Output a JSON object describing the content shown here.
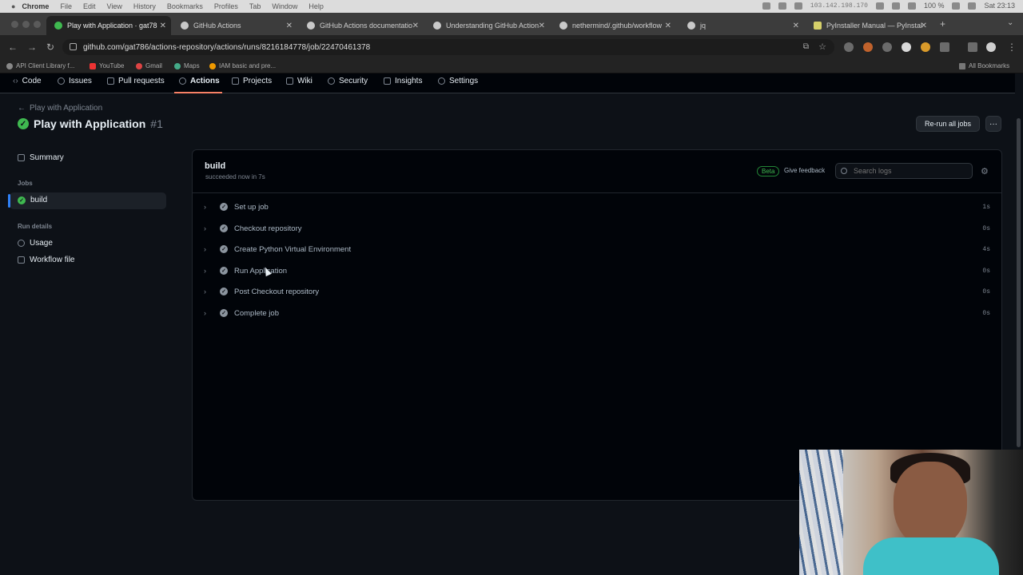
{
  "menubar": {
    "app": "Chrome",
    "items": [
      "File",
      "Edit",
      "View",
      "History",
      "Bookmarks",
      "Profiles",
      "Tab",
      "Window",
      "Help"
    ],
    "ip": "103.142.198.170",
    "battery": "100 %",
    "clock": "Sat 23:13"
  },
  "tabs": [
    {
      "label": "Play with Application · gat78",
      "icon": "github-actions-check-icon"
    },
    {
      "label": "GitHub Actions",
      "icon": "github-icon"
    },
    {
      "label": "GitHub Actions documentatio",
      "icon": "github-icon"
    },
    {
      "label": "Understanding GitHub Action",
      "icon": "github-icon"
    },
    {
      "label": "nethermind/.github/workflow",
      "icon": "github-icon"
    },
    {
      "label": "jq",
      "icon": "jq-icon"
    },
    {
      "label": "PyInstaller Manual — PyInstal",
      "icon": "python-icon"
    }
  ],
  "address": {
    "url": "github.com/gat786/actions-repository/actions/runs/8216184778/job/22470461378"
  },
  "bookmarks": [
    {
      "label": "API Client Library f..."
    },
    {
      "label": "YouTube"
    },
    {
      "label": "Gmail"
    },
    {
      "label": "Maps"
    },
    {
      "label": "IAM basic and pre..."
    }
  ],
  "bookmarks_right": "All Bookmarks",
  "repo_nav": {
    "items": [
      "Code",
      "Issues",
      "Pull requests",
      "Actions",
      "Projects",
      "Wiki",
      "Security",
      "Insights",
      "Settings"
    ],
    "active": "Actions"
  },
  "run": {
    "breadcrumb": "Play with Application",
    "title": "Play with Application",
    "number": "#1",
    "rerun_label": "Re-run all jobs",
    "more_label": "···"
  },
  "sidebar": {
    "summary": "Summary",
    "jobs_heading": "Jobs",
    "jobs": [
      "build"
    ],
    "details_heading": "Run details",
    "details": [
      "Usage",
      "Workflow file"
    ]
  },
  "job": {
    "name": "build",
    "status": "succeeded now in 7s",
    "beta": "Beta",
    "feedback": "Give feedback",
    "search_placeholder": "Search logs",
    "steps": [
      {
        "name": "Set up job",
        "duration": "1s"
      },
      {
        "name": "Checkout repository",
        "duration": "0s"
      },
      {
        "name": "Create Python Virtual Environment",
        "duration": "4s"
      },
      {
        "name": "Run Application",
        "duration": "0s"
      },
      {
        "name": "Post Checkout repository",
        "duration": "0s"
      },
      {
        "name": "Complete job",
        "duration": "0s"
      }
    ]
  },
  "colors": {
    "success": "#3fb950",
    "accent": "#f78166",
    "bg": "#0d1117"
  }
}
